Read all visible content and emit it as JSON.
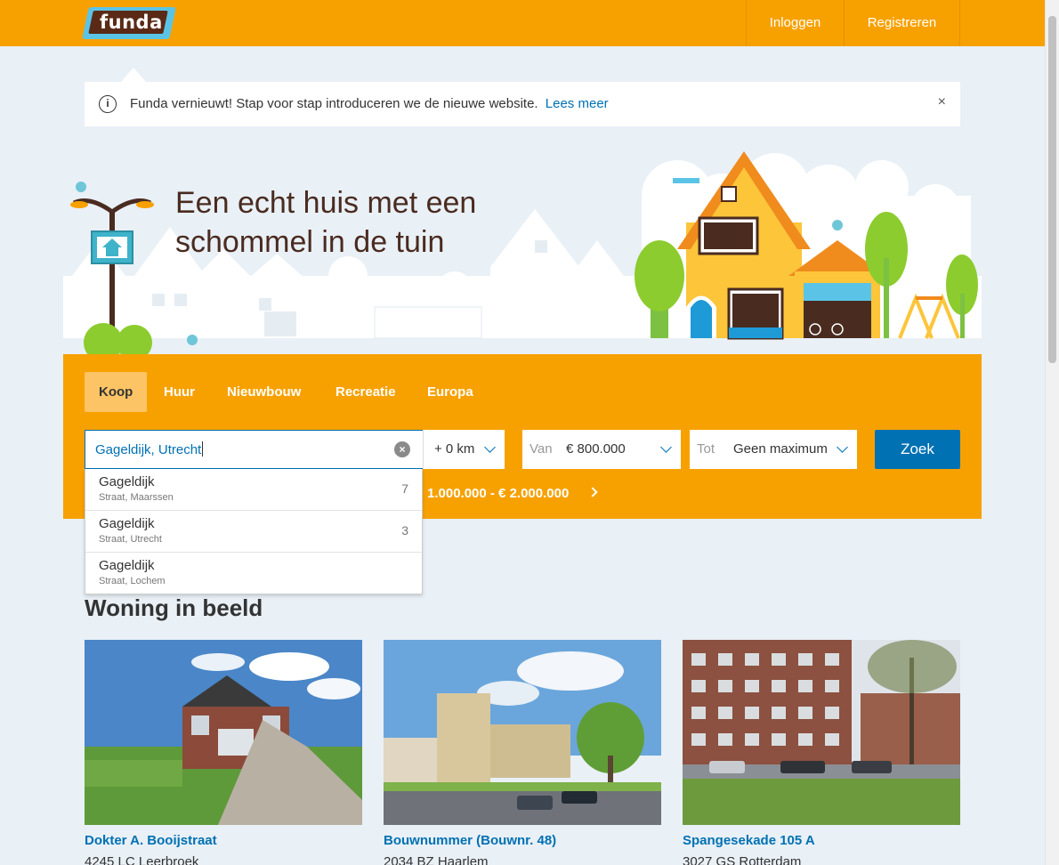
{
  "header": {
    "logo_text": "funda",
    "login_label": "Inloggen",
    "register_label": "Registreren"
  },
  "notice": {
    "text": "Funda vernieuwt! Stap voor stap introduceren we de nieuwe website.",
    "link_label": "Lees meer",
    "info_symbol": "i",
    "close_symbol": "×"
  },
  "hero": {
    "title": "Een echt huis met een schommel in de tuin"
  },
  "search": {
    "tabs": [
      {
        "label": "Koop",
        "active": true
      },
      {
        "label": "Huur",
        "active": false
      },
      {
        "label": "Nieuwbouw",
        "active": false
      },
      {
        "label": "Recreatie",
        "active": false
      },
      {
        "label": "Europa",
        "active": false
      }
    ],
    "query": "Gageldijk, Utrecht",
    "clear_symbol": "×",
    "radius": "+ 0 km",
    "price_from_label": "Van",
    "price_from_value": "€ 800.000",
    "price_to_label": "Tot",
    "price_to_value": "Geen maximum",
    "submit_label": "Zoek",
    "recent_search": "1.000.000 - € 2.000.000"
  },
  "suggestions": [
    {
      "name": "Gageldijk",
      "sub": "Straat, Maarssen",
      "count": "7"
    },
    {
      "name": "Gageldijk",
      "sub": "Straat, Utrecht",
      "count": "3"
    },
    {
      "name": "Gageldijk",
      "sub": "Straat, Lochem",
      "count": ""
    }
  ],
  "listings": {
    "title": "Woning in beeld",
    "items": [
      {
        "address": "Dokter A. Booijstraat",
        "zip": "4245 LC Leerbroek"
      },
      {
        "address": "Bouwnummer (Bouwnr. 48)",
        "zip": "2034 BZ Haarlem"
      },
      {
        "address": "Spangesekade 105 A",
        "zip": "3027 GS Rotterdam"
      }
    ]
  },
  "colors": {
    "brand_orange": "#f7a100",
    "link_blue": "#0071b3",
    "logo_cyan": "#5bc4e6",
    "logo_brown": "#5a2a16"
  }
}
